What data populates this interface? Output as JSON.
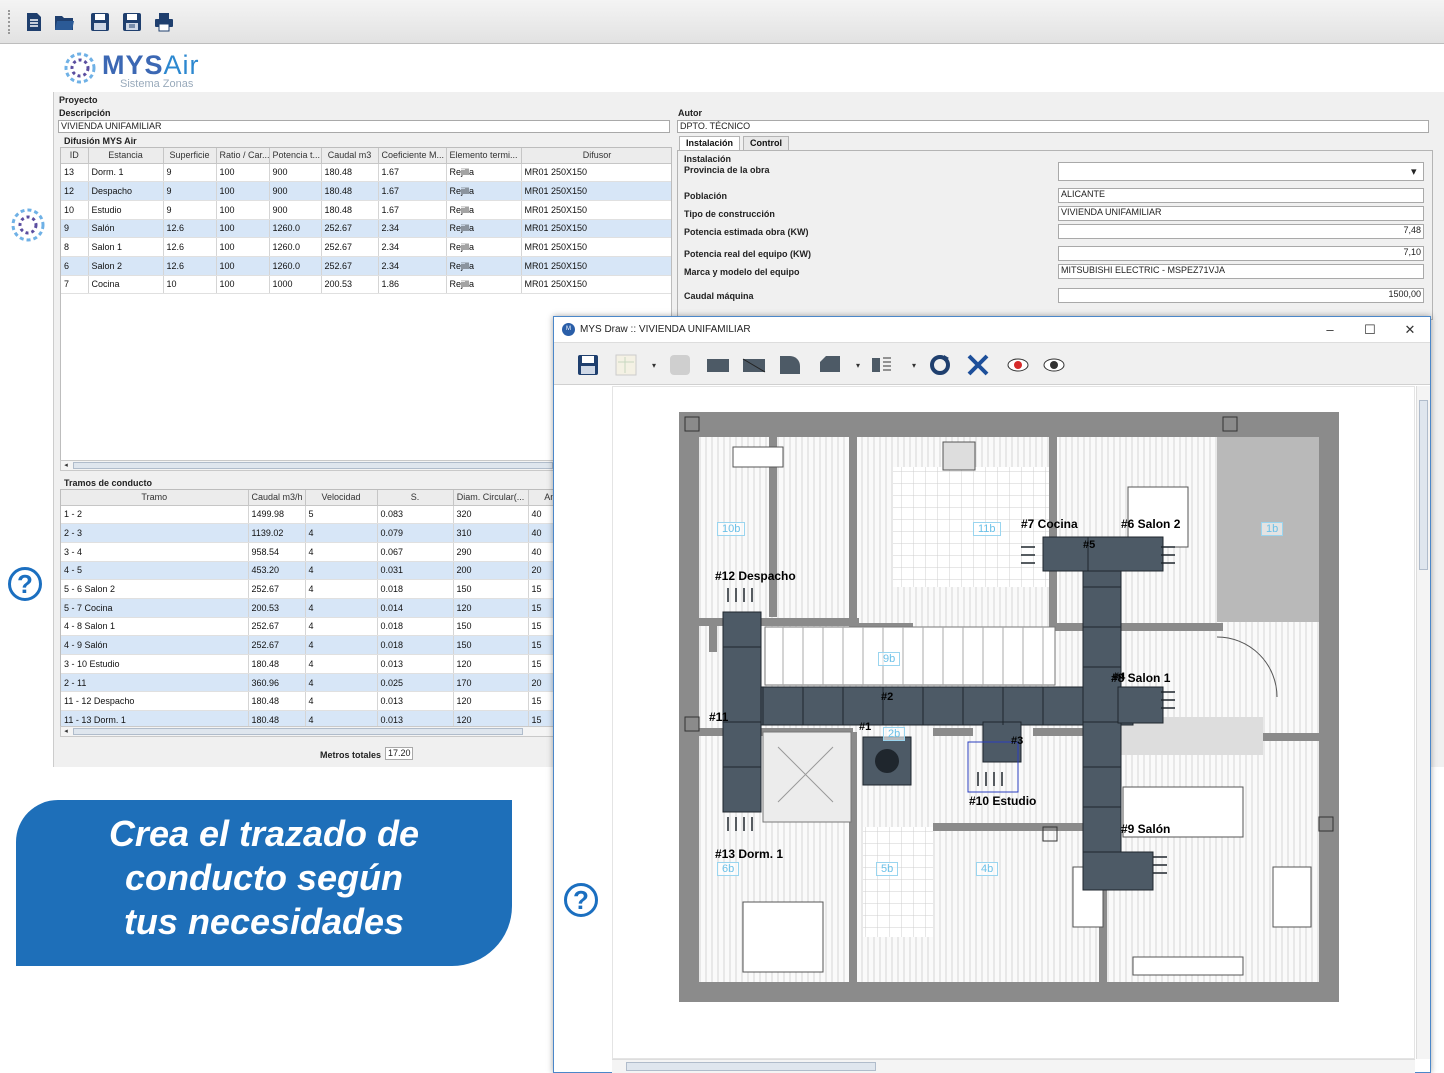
{
  "toolbar": {
    "icons": [
      "new-document-icon",
      "open-folder-icon",
      "save-icon",
      "save-as-icon",
      "print-icon"
    ]
  },
  "logo": {
    "brand": "MYS",
    "brand_suffix": "Air",
    "subtitle": "Sistema Zonas"
  },
  "project": {
    "section_label": "Proyecto",
    "description_label": "Descripción",
    "description_value": "VIVIENDA UNIFAMILIAR",
    "author_label": "Autor",
    "author_value": "DPTO. TÉCNICO"
  },
  "diffusion": {
    "title": "Difusión MYS Air",
    "columns": [
      "ID",
      "Estancia",
      "Superficie",
      "Ratio / Car...",
      "Potencia t...",
      "Caudal m3",
      "Coeficiente M...",
      "Elemento termi...",
      "Difusor"
    ],
    "rows": [
      [
        "13",
        "Dorm. 1",
        "9",
        "100",
        "900",
        "180.48",
        "1.67",
        "Rejilla",
        "MR01 250X150"
      ],
      [
        "12",
        "Despacho",
        "9",
        "100",
        "900",
        "180.48",
        "1.67",
        "Rejilla",
        "MR01 250X150"
      ],
      [
        "10",
        "Estudio",
        "9",
        "100",
        "900",
        "180.48",
        "1.67",
        "Rejilla",
        "MR01 250X150"
      ],
      [
        "9",
        "Salón",
        "12.6",
        "100",
        "1260.0",
        "252.67",
        "2.34",
        "Rejilla",
        "MR01 250X150"
      ],
      [
        "8",
        "Salon 1",
        "12.6",
        "100",
        "1260.0",
        "252.67",
        "2.34",
        "Rejilla",
        "MR01 250X150"
      ],
      [
        "6",
        "Salon 2",
        "12.6",
        "100",
        "1260.0",
        "252.67",
        "2.34",
        "Rejilla",
        "MR01 250X150"
      ],
      [
        "7",
        "Cocina",
        "10",
        "100",
        "1000",
        "200.53",
        "1.86",
        "Rejilla",
        "MR01 250X150"
      ]
    ]
  },
  "ducts": {
    "title": "Tramos de conducto",
    "columns": [
      "Tramo",
      "Caudal m3/h",
      "Velocidad",
      "S.",
      "Diam. Circular(...",
      "Anch"
    ],
    "rows": [
      [
        "1 - 2",
        "1499.98",
        "5",
        "0.083",
        "320",
        "40"
      ],
      [
        "2 - 3",
        "1139.02",
        "4",
        "0.079",
        "310",
        "40"
      ],
      [
        "3 - 4",
        "958.54",
        "4",
        "0.067",
        "290",
        "40"
      ],
      [
        "4 - 5",
        "453.20",
        "4",
        "0.031",
        "200",
        "20"
      ],
      [
        "5 - 6 Salon 2",
        "252.67",
        "4",
        "0.018",
        "150",
        "15"
      ],
      [
        "5 - 7 Cocina",
        "200.53",
        "4",
        "0.014",
        "120",
        "15"
      ],
      [
        "4 - 8 Salon 1",
        "252.67",
        "4",
        "0.018",
        "150",
        "15"
      ],
      [
        "4 - 9 Salón",
        "252.67",
        "4",
        "0.018",
        "150",
        "15"
      ],
      [
        "3 - 10 Estudio",
        "180.48",
        "4",
        "0.013",
        "120",
        "15"
      ],
      [
        "2 - 11",
        "360.96",
        "4",
        "0.025",
        "170",
        "20"
      ],
      [
        "11 - 12 Despacho",
        "180.48",
        "4",
        "0.013",
        "120",
        "15"
      ],
      [
        "11 - 13 Dorm. 1",
        "180.48",
        "4",
        "0.013",
        "120",
        "15"
      ]
    ],
    "total_label": "Metros totales",
    "total_value": "17.20"
  },
  "tabs": [
    "Instalación",
    "Control"
  ],
  "installation": {
    "title": "Instalación",
    "fields": [
      {
        "label": "Provincia de la obra",
        "value": ""
      },
      {
        "label": "Población",
        "value": "ALICANTE"
      },
      {
        "label": "Tipo de construcción",
        "value": "VIVIENDA UNIFAMILIAR"
      },
      {
        "label": "Potencia estimada obra (KW)",
        "value": "7,48"
      },
      {
        "label": "Potencia real del equipo (KW)",
        "value": "7,10"
      },
      {
        "label": "Marca y modelo del equipo",
        "value": "MITSUBISHI ELECTRIC - MSPEZ71VJA"
      },
      {
        "label": "Caudal máquina",
        "value": "1500,00"
      }
    ]
  },
  "draw_window": {
    "title": "MYS Draw :: VIVIENDA UNIFAMILIAR",
    "controls": [
      "–",
      "☐",
      "✕"
    ],
    "room_labels": [
      "#7 Cocina",
      "#6 Salon 2",
      "#12 Despacho",
      "#8 Salon 1",
      "#11",
      "#10 Estudio",
      "#9 Salón",
      "#13 Dorm. 1"
    ],
    "node_labels": [
      "#5",
      "#2",
      "#1",
      "#3",
      "#4"
    ],
    "room_tags": [
      "10b",
      "11b",
      "1b",
      "9b",
      "6b",
      "5b",
      "4b",
      "2b"
    ]
  },
  "banner": {
    "line1": "Crea el trazado de",
    "line2": "conducto según",
    "line3": "tus necesidades"
  },
  "colors": {
    "accent": "#1e6fb9",
    "row_alt": "#d7e6f7",
    "duct": "#4d5a66"
  }
}
